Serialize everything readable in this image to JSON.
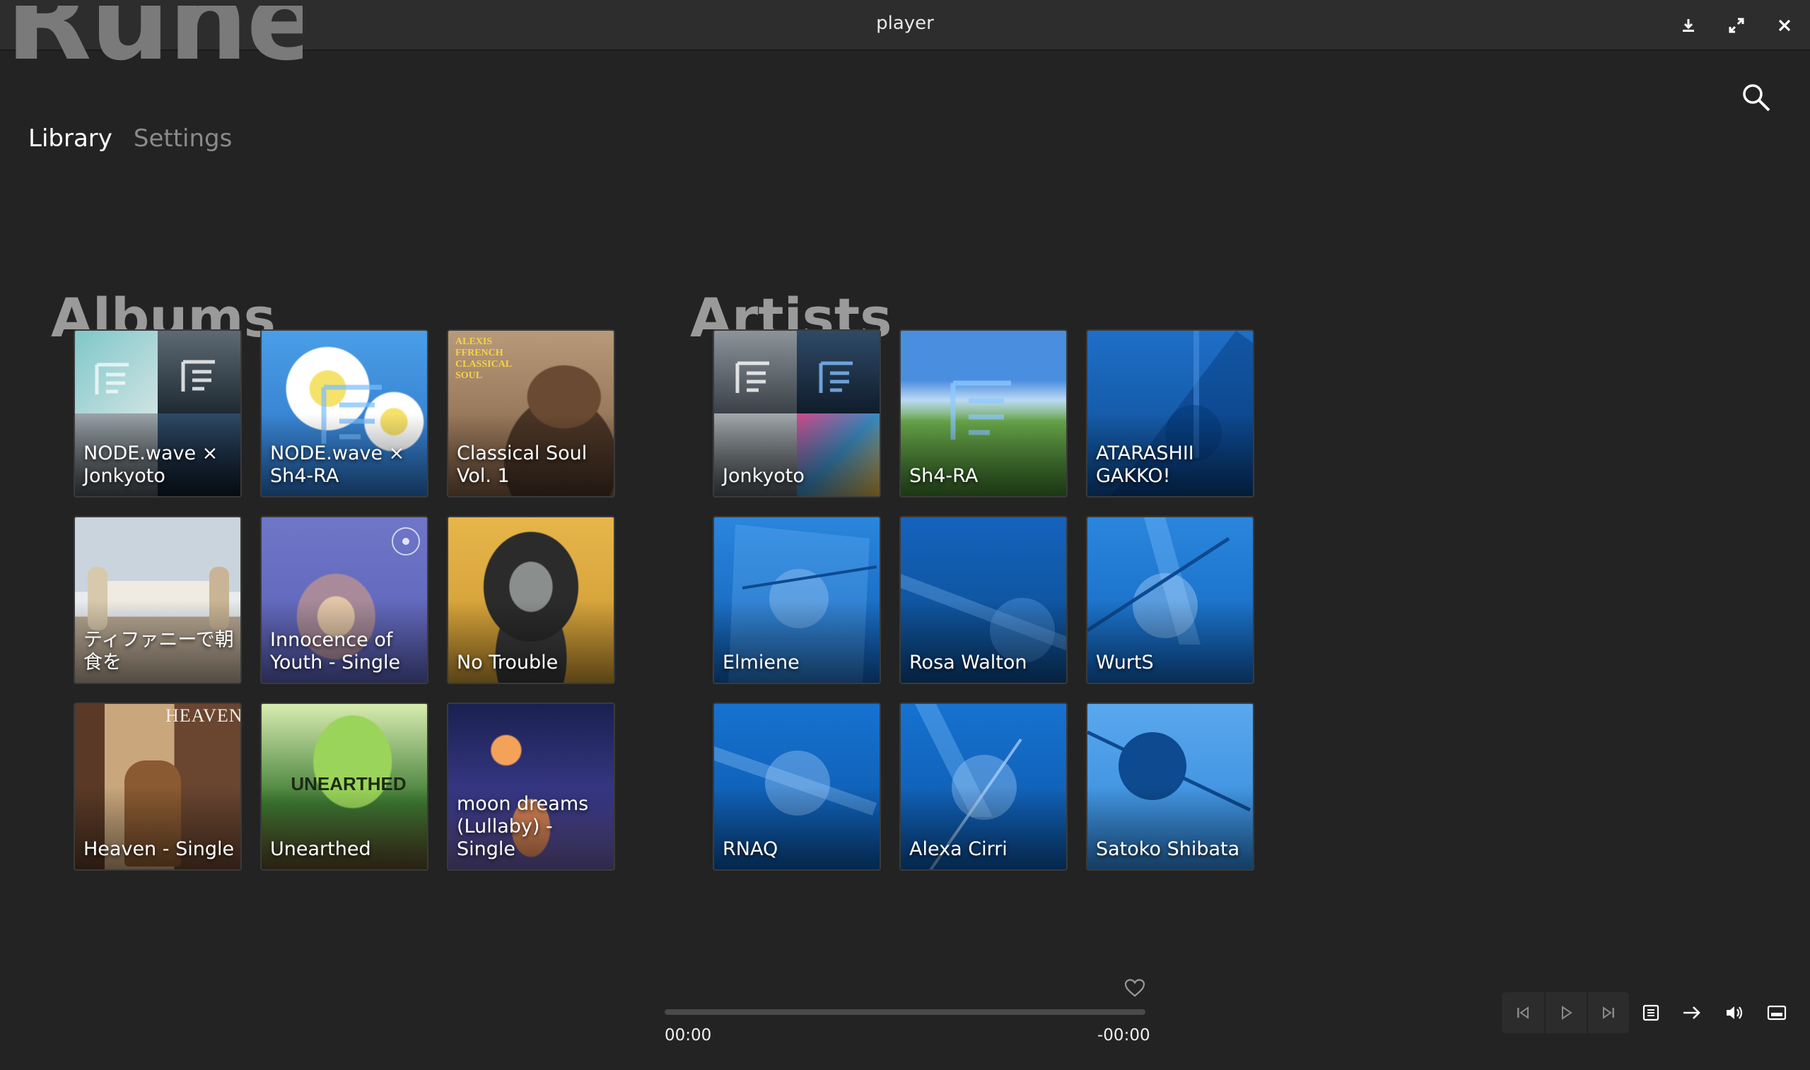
{
  "window": {
    "title": "player"
  },
  "brand": "Rune",
  "nav": {
    "library": "Library",
    "settings": "Settings"
  },
  "albums": {
    "title": "Albums",
    "items": [
      {
        "label": "NODE.wave × Jonkyoto"
      },
      {
        "label": "NODE.wave × Sh4-RA"
      },
      {
        "label": "Classical Soul Vol. 1"
      },
      {
        "label": "ティファニーで朝食を"
      },
      {
        "label": "Innocence of Youth - Single"
      },
      {
        "label": "No Trouble"
      },
      {
        "label": "Heaven - Single"
      },
      {
        "label": "Unearthed"
      },
      {
        "label": "moon dreams (Lullaby) - Single"
      }
    ]
  },
  "artists": {
    "title": "Artists",
    "items": [
      {
        "label": "Jonkyoto"
      },
      {
        "label": "Sh4-RA"
      },
      {
        "label": "ATARASHII GAKKO!"
      },
      {
        "label": "Elmiene"
      },
      {
        "label": "Rosa Walton"
      },
      {
        "label": "WurtS"
      },
      {
        "label": "RNAQ"
      },
      {
        "label": "Alexa Cirri"
      },
      {
        "label": "Satoko Shibata"
      }
    ]
  },
  "album_art_text": {
    "classical_top": "ALEXIS FFRENCH CLASSICAL SOUL",
    "heaven_top": "HEAVEN",
    "unearthed_top": "UNEARTHED"
  },
  "player": {
    "elapsed": "00:00",
    "remaining": "-00:00",
    "progress": 0
  },
  "colors": {
    "background": "#232323",
    "titlebar": "#2d2d2d",
    "artist_blue": "#1565c0"
  }
}
